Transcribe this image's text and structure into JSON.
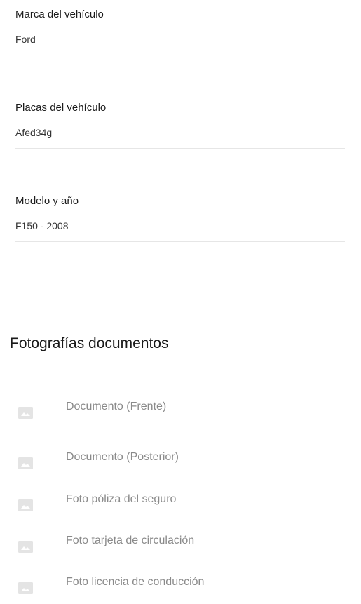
{
  "vehicle": {
    "brand": {
      "label": "Marca del vehículo",
      "value": "Ford"
    },
    "plates": {
      "label": "Placas del vehículo",
      "value": "Afed34g"
    },
    "model": {
      "label": "Modelo y año",
      "value": "F150 - 2008"
    }
  },
  "documents": {
    "title": "Fotografías documentos",
    "icon": "image-placeholder-icon",
    "icon_color": "#e4e4e4",
    "items": [
      {
        "label": "Documento (Frente)"
      },
      {
        "label": "Documento (Posterior)"
      },
      {
        "label": "Foto póliza del seguro"
      },
      {
        "label": "Foto tarjeta de circulación"
      },
      {
        "label": "Foto licencia de conducción"
      }
    ]
  }
}
